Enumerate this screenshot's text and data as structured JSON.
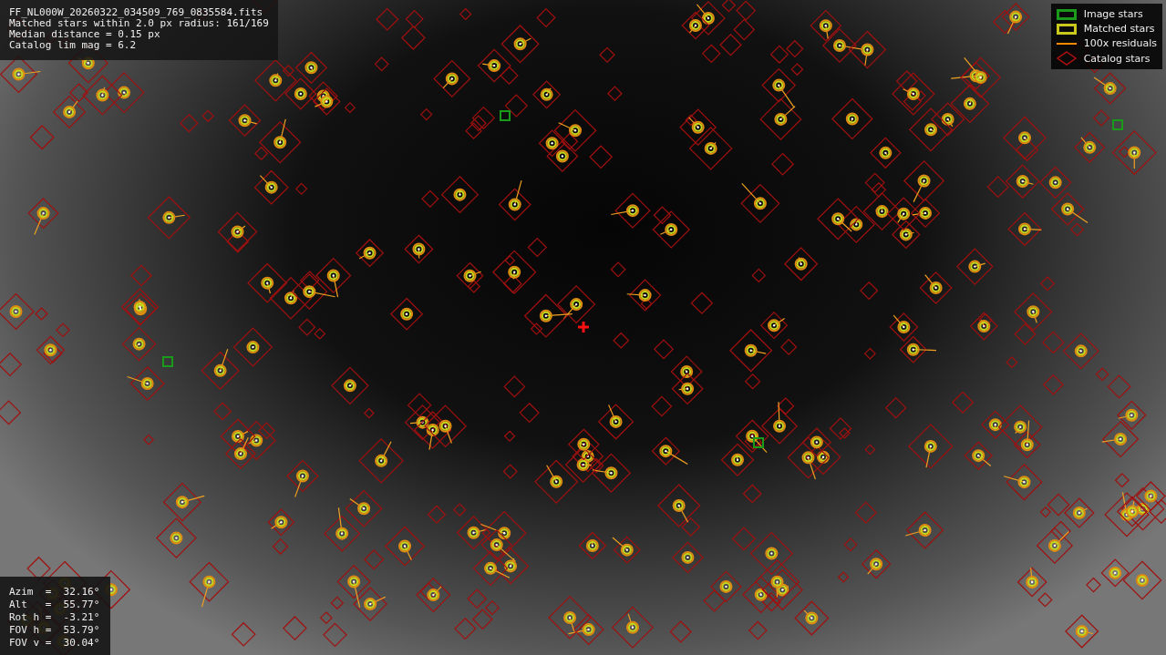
{
  "info_lines": [
    "FF_NL000W_20260322_034509_769_0835584.fits",
    "Matched stars within 2.0 px radius: 161/169",
    "Median distance = 0.15 px",
    "Catalog lim mag = 6.2"
  ],
  "legend": [
    {
      "kind": "box",
      "label": "Image stars",
      "color": "#1a9a1a"
    },
    {
      "kind": "box",
      "label": "Matched stars",
      "color": "#c8c81e"
    },
    {
      "kind": "line",
      "label": "100x residuals",
      "color": "#ff8c00"
    },
    {
      "kind": "diamond",
      "label": "Catalog stars",
      "color": "#b01010"
    }
  ],
  "pointing": [
    "Azim  =  32.16°",
    "Alt   =  55.77°",
    "Rot h =  -3.21°",
    "FOV h =  53.79°",
    "FOV v =  30.04°"
  ]
}
